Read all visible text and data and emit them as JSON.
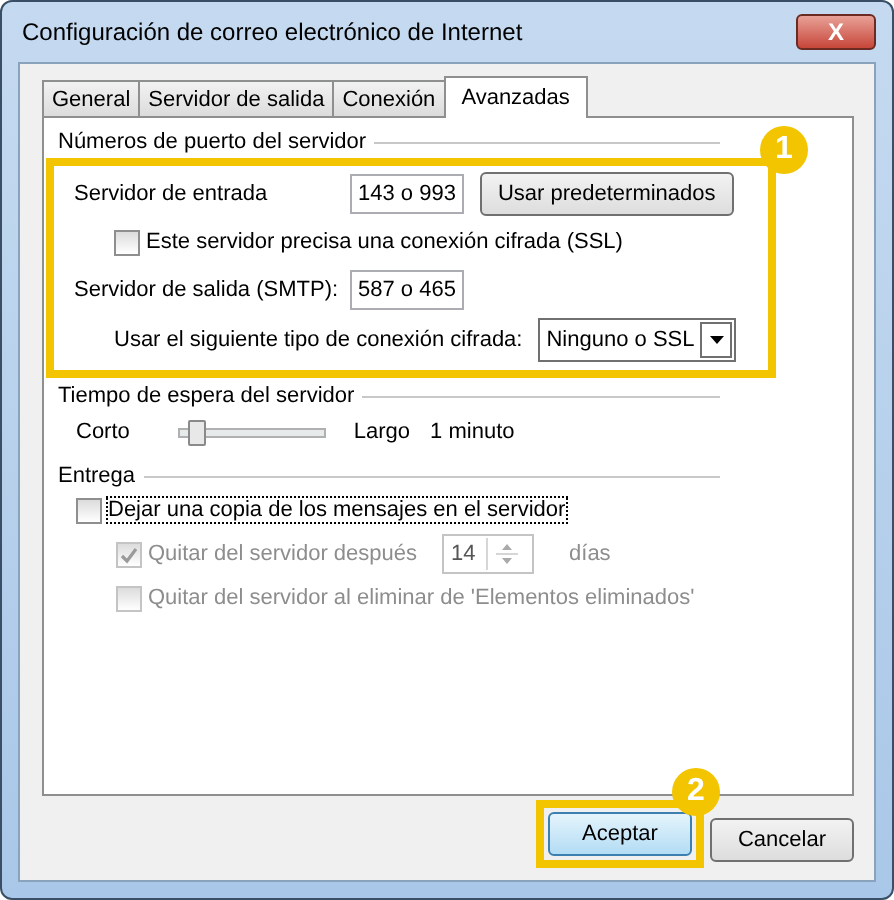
{
  "window": {
    "title": "Configuración de correo electrónico de Internet",
    "close": "X"
  },
  "tabs": [
    {
      "label": "General",
      "selected": false
    },
    {
      "label": "Servidor de salida",
      "selected": false
    },
    {
      "label": "Conexión",
      "selected": false
    },
    {
      "label": "Avanzadas",
      "selected": true
    }
  ],
  "ports": {
    "title": "Números de puerto del servidor",
    "callout": "1",
    "incoming_label": "Servidor de entrada",
    "incoming_value": "143 o 993",
    "defaults_button": "Usar predeterminados",
    "ssl": {
      "label": "Este servidor precisa una conexión cifrada (SSL)",
      "checked": false
    },
    "outgoing_label": "Servidor de salida (SMTP):",
    "outgoing_value": "587 o 465",
    "encryption_label": "Usar el siguiente tipo de conexión cifrada:",
    "encryption_value": "Ninguno o SSL"
  },
  "timeout": {
    "title": "Tiempo de espera del servidor",
    "short_label": "Corto",
    "long_label": "Largo",
    "level": 0.05,
    "reading": "1 minuto"
  },
  "delivery": {
    "title": "Entrega",
    "options": [
      {
        "kind": "checkbox",
        "label": "Dejar una copia de los mensajes en el servidor",
        "checked": false,
        "disabled": false
      },
      {
        "kind": "spinner",
        "label": "Quitar del servidor después",
        "checked": true,
        "disabled": true,
        "value": "14",
        "unit": "días"
      },
      {
        "kind": "checkbox",
        "label": "Quitar del servidor al eliminar de 'Elementos eliminados'",
        "checked": false,
        "disabled": true
      }
    ]
  },
  "buttons": [
    {
      "label": "Aceptar",
      "default": true,
      "callout": "2"
    },
    {
      "label": "Cancelar",
      "default": false
    }
  ]
}
